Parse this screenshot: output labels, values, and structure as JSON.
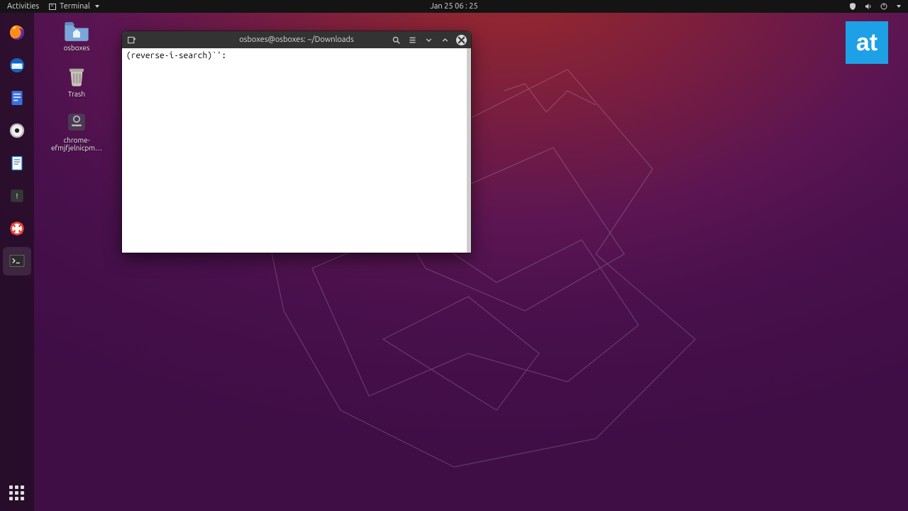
{
  "topbar": {
    "activities": "Activities",
    "app_name": "Terminal",
    "datetime": "Jan 25  06 : 25"
  },
  "dock": {
    "items": [
      {
        "name": "firefox"
      },
      {
        "name": "thunderbird"
      },
      {
        "name": "todo"
      },
      {
        "name": "rhythmbox"
      },
      {
        "name": "libreoffice-writer"
      },
      {
        "name": "software-updater"
      },
      {
        "name": "help"
      },
      {
        "name": "terminal"
      }
    ]
  },
  "desktop_icons": [
    {
      "label": "osboxes",
      "icon": "home-folder"
    },
    {
      "label": "Trash",
      "icon": "trash"
    },
    {
      "label": "chrome-efmjfjelnicpm…",
      "icon": "app-placeholder"
    }
  ],
  "terminal": {
    "title": "osboxes@osboxes: ~/Downloads",
    "content": "(reverse-i-search)`':"
  },
  "badge": {
    "text": "at"
  }
}
